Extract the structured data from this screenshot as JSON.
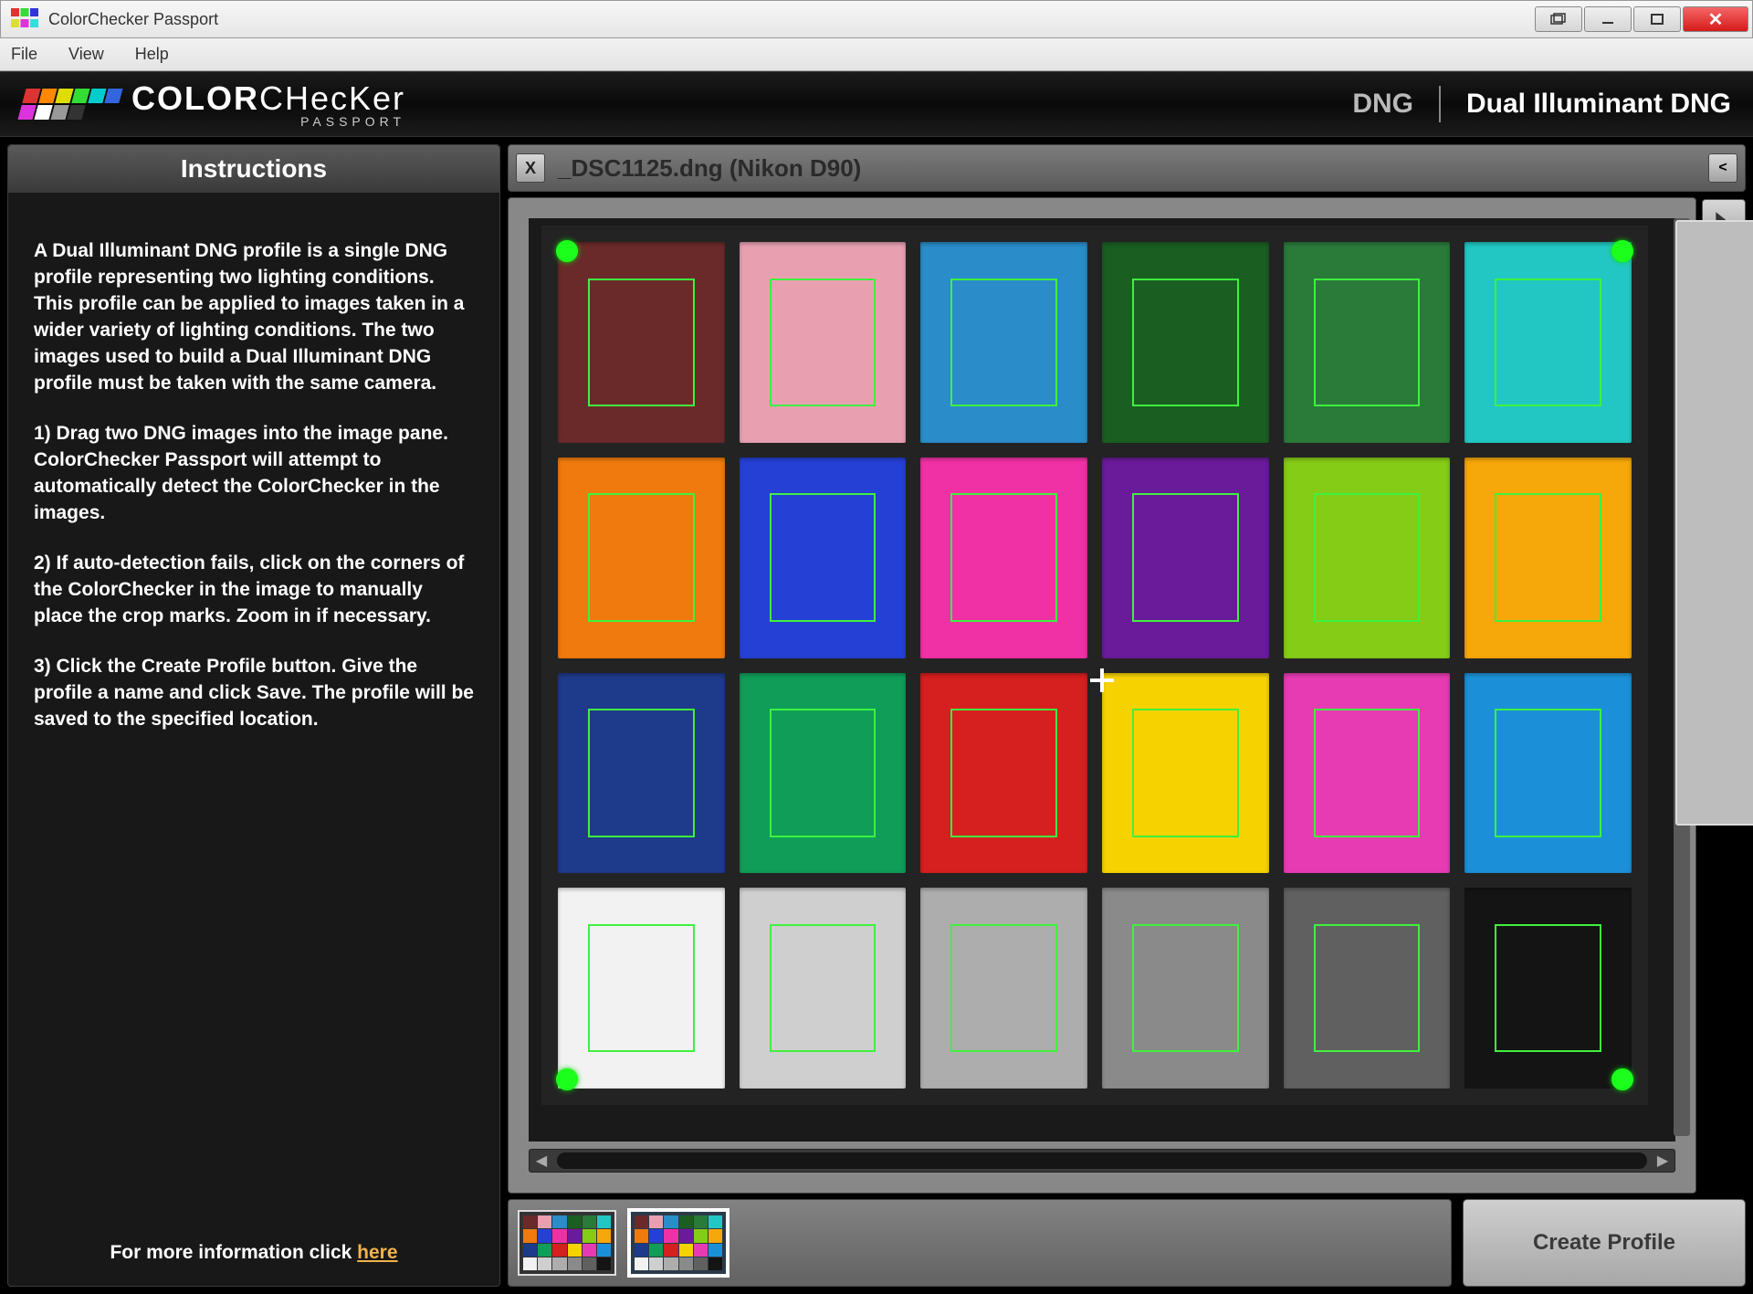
{
  "window": {
    "title": "ColorChecker Passport"
  },
  "menubar": {
    "file": "File",
    "view": "View",
    "help": "Help"
  },
  "brand": {
    "name_bold": "COLOR",
    "name_rest": "CHecKer",
    "sub": "PASSPORT"
  },
  "modes": {
    "dng": "DNG",
    "dual": "Dual Illuminant DNG"
  },
  "sidebar": {
    "title": "Instructions",
    "p1": "A Dual Illuminant DNG profile is a single DNG profile representing two lighting conditions. This profile can be applied to images taken in a wider variety of lighting conditions. The two images used to build a Dual Illuminant DNG profile must be taken with the same camera.",
    "p2": "1) Drag two DNG images into the image pane. ColorChecker Passport will attempt to automatically detect the ColorChecker in the images.",
    "p3": "2) If auto-detection fails, click on the corners of the ColorChecker in the image to manually place the crop marks. Zoom in if necessary.",
    "p4": "3) Click the Create Profile button. Give the profile a name and click Save. The profile will be saved to the specified location.",
    "foot_pre": "For more information click ",
    "foot_link": "here"
  },
  "tab": {
    "close": "X",
    "filename": "_DSC1125.dng (Nikon D90)",
    "toggle": "<"
  },
  "patches": [
    "#6b2a2a",
    "#e8a0b1",
    "#2a8cc8",
    "#1a5e22",
    "#2a7a3a",
    "#22c7c3",
    "#f07a0e",
    "#2540d5",
    "#f031a5",
    "#6a1b9a",
    "#84cc16",
    "#f6a70a",
    "#1e3a8a",
    "#0f9d58",
    "#d61f1f",
    "#f6d200",
    "#e63bb2",
    "#1b90d8",
    "#f2f2f2",
    "#cfcfcf",
    "#adadad",
    "#8a8a8a",
    "#606060",
    "#141414"
  ],
  "buttons": {
    "create": "Create Profile"
  },
  "thumb_patches": [
    "#6b2a2a",
    "#e8a0b1",
    "#2a8cc8",
    "#1a5e22",
    "#2a7a3a",
    "#22c7c3",
    "#f07a0e",
    "#2540d5",
    "#f031a5",
    "#6a1b9a",
    "#84cc16",
    "#f6a70a",
    "#1e3a8a",
    "#0f9d58",
    "#d61f1f",
    "#f6d200",
    "#e63bb2",
    "#1b90d8",
    "#f2f2f2",
    "#cfcfcf",
    "#adadad",
    "#8a8a8a",
    "#606060",
    "#141414"
  ]
}
